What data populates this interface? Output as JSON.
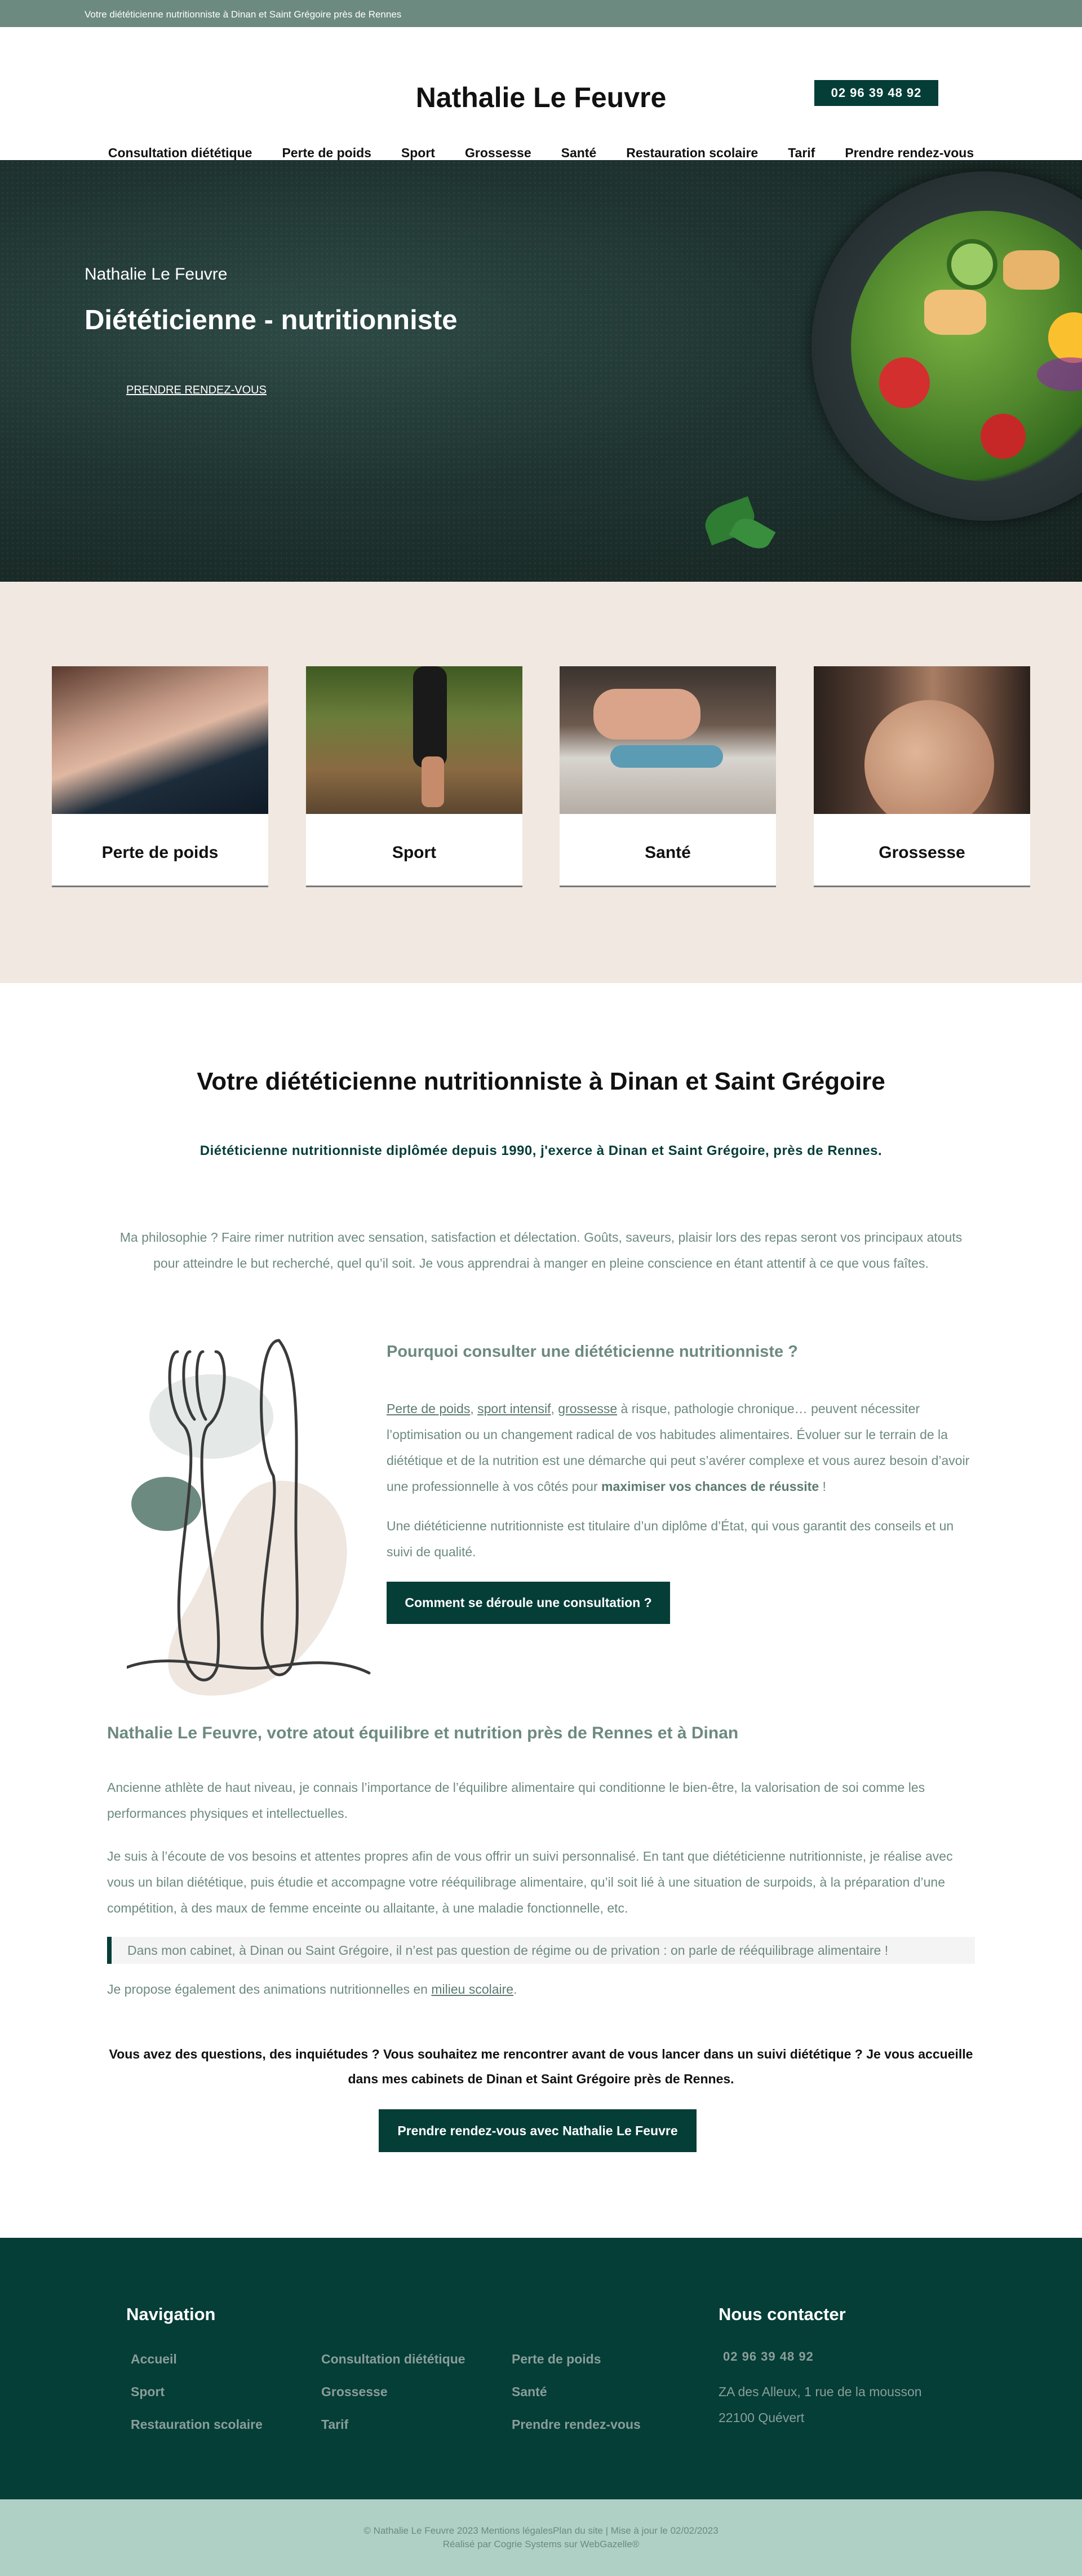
{
  "topbar": {
    "text": "Votre diététicienne nutritionniste à Dinan et Saint Grégoire près de Rennes"
  },
  "header": {
    "site_title": "Nathalie Le Feuvre",
    "phone": "02 96 39 48 92",
    "nav": [
      "Consultation diététique",
      "Perte de poids",
      "Sport",
      "Grossesse",
      "Santé",
      "Restauration scolaire",
      "Tarif",
      "Prendre rendez-vous"
    ]
  },
  "hero": {
    "kicker": "Nathalie Le Feuvre",
    "title": "Diététicienne - nutritionniste",
    "link": "PRENDRE RENDEZ-VOUS"
  },
  "categories": [
    {
      "label": "Perte de poids"
    },
    {
      "label": "Sport"
    },
    {
      "label": "Santé"
    },
    {
      "label": "Grossesse"
    }
  ],
  "main": {
    "title": "Votre diététicienne nutritionniste à Dinan et Saint Grégoire",
    "lead": "Diététicienne nutritionniste diplômée depuis 1990, j'exerce à Dinan et Saint Grégoire, près de Rennes.",
    "philosophy": "Ma philosophie ? Faire rimer nutrition avec sensation, satisfaction et délectation. Goûts, saveurs, plaisir lors des repas seront vos principaux atouts pour atteindre le but recherché, quel qu’il soit. Je vous apprendrai à manger en pleine conscience en étant attentif à ce que vous faîtes.",
    "why": {
      "title": "Pourquoi consulter une diététicienne nutritionniste ?",
      "link1": "Perte de poids",
      "sep1": ", ",
      "link2": "sport intensif",
      "sep2": ", ",
      "link3": "grossesse",
      "text1": " à risque, pathologie chronique… peuvent nécessiter l’optimisation ou un changement radical de vos habitudes alimentaires. Évoluer sur le terrain de la diététique et de la nutrition est une démarche qui peut s’avérer complexe et vous aurez besoin d’avoir une professionnelle à vos côtés pour ",
      "bold": "maximiser vos chances de réussite",
      "text2": " !",
      "p2": "Une diététicienne nutritionniste est titulaire d’un diplôme d’État, qui vous garantit des conseils et un suivi de qualité.",
      "button": "Comment se déroule une consultation ?"
    },
    "atout": {
      "title": "Nathalie Le Feuvre, votre atout équilibre et nutrition près de Rennes et à Dinan",
      "p1": "Ancienne athlète de haut niveau, je connais l’importance de l’équilibre alimentaire qui conditionne le bien-être, la valorisation de soi comme les performances physiques et intellectuelles.",
      "p2": "Je suis à l’écoute de vos besoins et attentes propres afin de vous offrir un suivi personnalisé. En tant que diététicienne nutritionniste, je réalise avec vous un bilan diététique, puis étudie et accompagne votre rééquilibrage alimentaire, qu’il soit lié à une situation de surpoids, à la préparation d’une compétition, à des maux de femme enceinte ou allaitante, à une maladie fonctionnelle, etc.",
      "quote": "Dans mon cabinet, à Dinan ou Saint Grégoire, il n’est pas question de régime ou de privation : on parle de rééquilibrage alimentaire !",
      "p3_text": "Je propose également des animations nutritionnelles en ",
      "p3_link": "milieu scolaire",
      "p3_end": "."
    },
    "cta": {
      "question": "Vous avez des questions, des inquiétudes ? Vous souhaitez me rencontrer avant de vous lancer dans un suivi diététique ? Je vous accueille dans mes cabinets de Dinan et Saint Grégoire près de Rennes.",
      "button": "Prendre rendez-vous avec Nathalie Le Feuvre"
    }
  },
  "footer": {
    "nav_title": "Navigation",
    "nav_links": [
      "Accueil",
      "Consultation diététique",
      "Perte de poids",
      "Sport",
      "Grossesse",
      "Santé",
      "Restauration scolaire",
      "Tarif",
      "Prendre rendez-vous"
    ],
    "contact_title": "Nous contacter",
    "phone": "02 96 39 48 92",
    "address1": "ZA des Alleux, 1 rue de la mousson",
    "address2": "22100 Quévert",
    "bottom_line1": "© Nathalie Le Feuvre 2023 Mentions légalesPlan du site | Mise à jour le 02/02/2023",
    "bottom_line2": "Réalisé par Cogrie Systems sur WebGazelle®"
  },
  "colors": {
    "primary_dark": "#053d37",
    "topbar": "#6d8a80",
    "beige": "#f0e8e1",
    "mint": "#afd0c5"
  }
}
